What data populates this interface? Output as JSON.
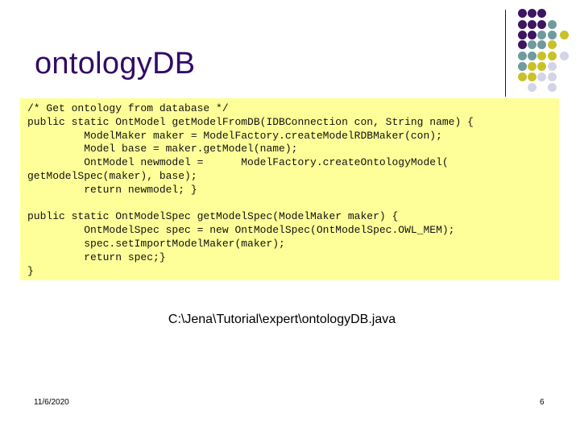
{
  "slide": {
    "title": "ontologyDB",
    "code_lines": [
      "/* Get ontology from database */",
      "public static OntModel getModelFromDB(IDBConnection con, String name) {",
      "         ModelMaker maker = ModelFactory.createModelRDBMaker(con);",
      "         Model base = maker.getModel(name);",
      "         OntModel newmodel =      ModelFactory.createOntologyModel(",
      "getModelSpec(maker), base);",
      "         return newmodel; }",
      "",
      "public static OntModelSpec getModelSpec(ModelMaker maker) {",
      "         OntModelSpec spec = new OntModelSpec(OntModelSpec.OWL_MEM);",
      "         spec.setImportModelMaker(maker);",
      "         return spec;}",
      "}"
    ],
    "file_path": "C:\\Jena\\Tutorial\\expert\\ontologyDB.java",
    "footer": {
      "date": "11/6/2020",
      "page_number": "6"
    }
  },
  "theme": {
    "title_color": "#330a66",
    "code_background": "#ffff99",
    "dot_colors": {
      "P": "#3d1560",
      "T": "#6e9b9e",
      "Y": "#c9c12a",
      "L": "#d4d4e8"
    },
    "dot_grid": [
      "PPP--",
      "PPPT-",
      "PPTTY",
      "PTTY-",
      "TTYYL",
      "TYYL-",
      "YYLL-",
      "-L-L-"
    ]
  }
}
